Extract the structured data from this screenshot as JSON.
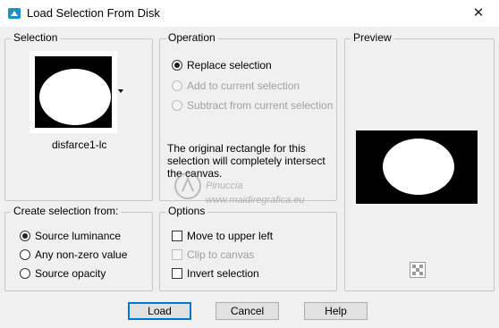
{
  "window": {
    "title": "Load Selection From Disk",
    "close_glyph": "✕"
  },
  "selection": {
    "label": "Selection",
    "filename": "disfarce1-lc"
  },
  "operation": {
    "label": "Operation",
    "options": [
      {
        "label": "Replace selection",
        "checked": true,
        "disabled": false
      },
      {
        "label": "Add to current selection",
        "checked": false,
        "disabled": true
      },
      {
        "label": "Subtract from current selection",
        "checked": false,
        "disabled": true
      }
    ],
    "info": "The original rectangle for this selection will completely intersect the canvas."
  },
  "preview": {
    "label": "Preview",
    "zoom_icon": "checkerboard-icon"
  },
  "create_from": {
    "label": "Create selection from:",
    "options": [
      {
        "label": "Source luminance",
        "checked": true
      },
      {
        "label": "Any non-zero value",
        "checked": false
      },
      {
        "label": "Source opacity",
        "checked": false
      }
    ]
  },
  "options": {
    "label": "Options",
    "items": [
      {
        "label": "Move to upper left",
        "checked": false,
        "disabled": false
      },
      {
        "label": "Clip to canvas",
        "checked": false,
        "disabled": true
      },
      {
        "label": "Invert selection",
        "checked": false,
        "disabled": false
      }
    ]
  },
  "buttons": {
    "load": "Load",
    "cancel": "Cancel",
    "help": "Help"
  },
  "watermark": {
    "line1": "Pinuccia",
    "line2": "www.maidiregrafica.eu"
  },
  "colors": {
    "accent": "#0078d7",
    "title_icon": "#1a8fc9"
  }
}
